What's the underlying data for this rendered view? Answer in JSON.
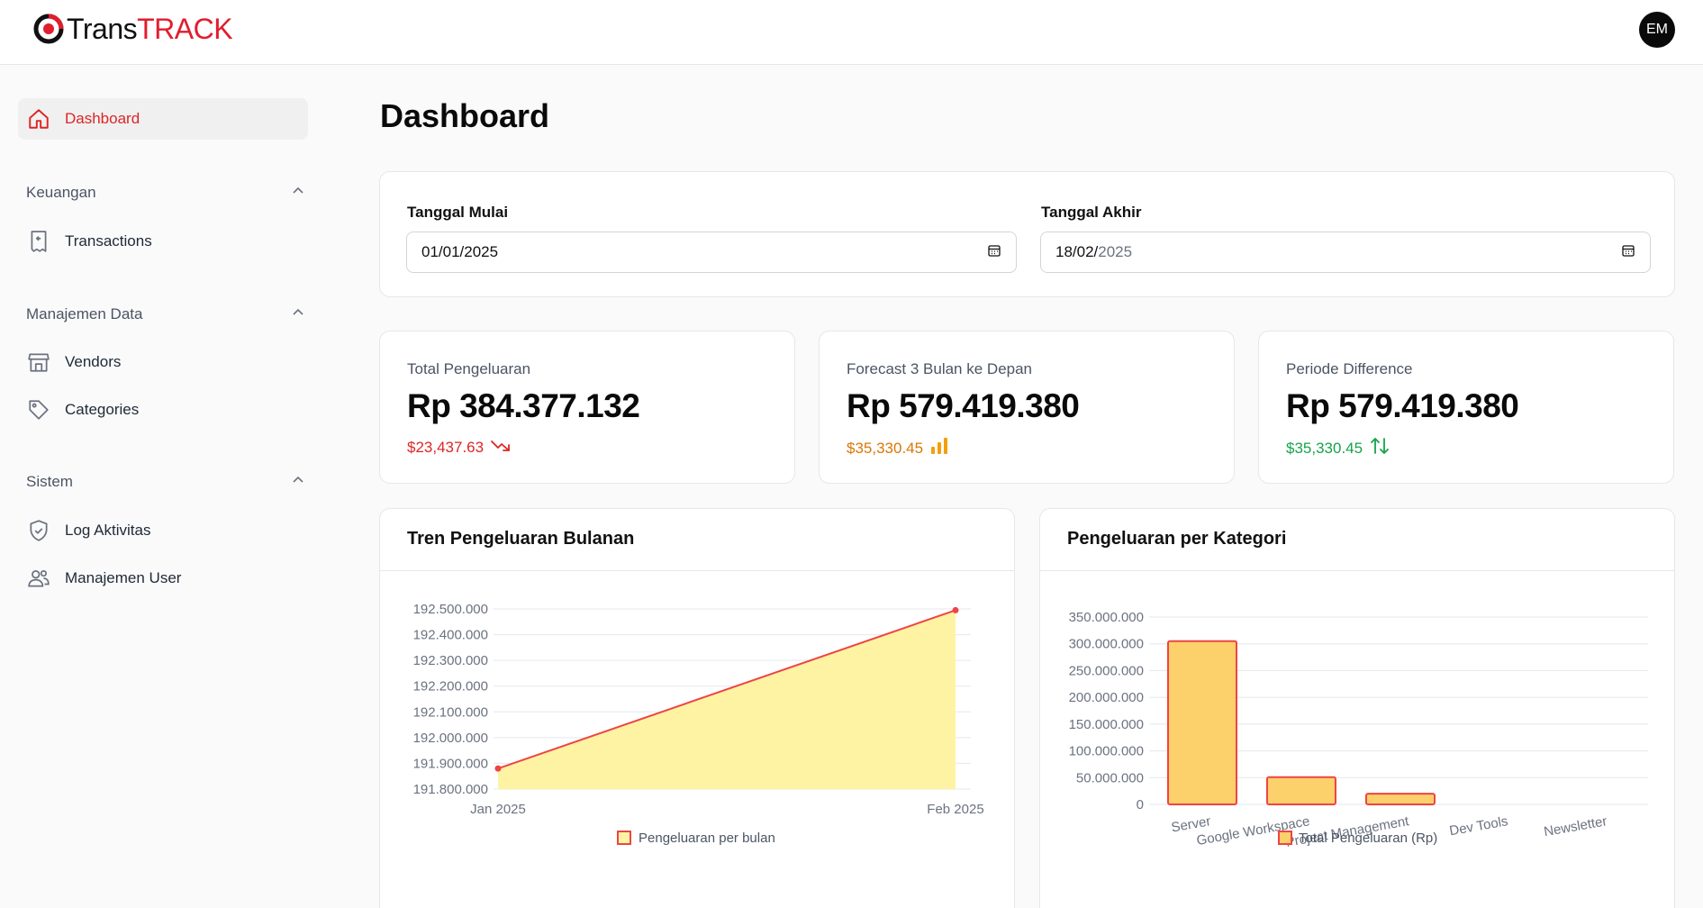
{
  "brand": {
    "name_part1": "Trans",
    "name_part2": "TRACK",
    "accent_color": "#e11d2e"
  },
  "user": {
    "initials": "EM"
  },
  "sidebar": {
    "dashboard": {
      "label": "Dashboard",
      "icon": "home-icon",
      "active": true
    },
    "groups": [
      {
        "title": "Keuangan",
        "items": [
          {
            "label": "Transactions",
            "icon": "receipt-icon"
          }
        ]
      },
      {
        "title": "Manajemen Data",
        "items": [
          {
            "label": "Vendors",
            "icon": "store-icon"
          },
          {
            "label": "Categories",
            "icon": "tag-icon"
          }
        ]
      },
      {
        "title": "Sistem",
        "items": [
          {
            "label": "Log Aktivitas",
            "icon": "shield-icon"
          },
          {
            "label": "Manajemen User",
            "icon": "users-icon"
          }
        ]
      }
    ]
  },
  "page": {
    "title": "Dashboard"
  },
  "filters": {
    "start": {
      "label": "Tanggal Mulai",
      "value": "01/01/2025"
    },
    "end": {
      "label": "Tanggal Akhir",
      "value_day_month": "18/02/",
      "value_year": "2025"
    }
  },
  "stats": [
    {
      "label": "Total Pengeluaran",
      "value": "Rp 384.377.132",
      "sub": "$23,437.63",
      "sub_color": "#dc2626",
      "sub_icon": "trend-down-icon"
    },
    {
      "label": "Forecast 3 Bulan ke Depan",
      "value": "Rp 579.419.380",
      "sub": "$35,330.45",
      "sub_color": "#d97706",
      "sub_icon": "bar-chart-icon"
    },
    {
      "label": "Periode Difference",
      "value": "Rp 579.419.380",
      "sub": "$35,330.45",
      "sub_color": "#16a34a",
      "sub_icon": "arrows-up-down-icon"
    }
  ],
  "charts": {
    "trend_title": "Tren Pengeluaran Bulanan",
    "category_title": "Pengeluaran per Kategori"
  },
  "chart_data": [
    {
      "type": "area",
      "title": "Tren Pengeluaran Bulanan",
      "x": [
        "Jan 2025",
        "Feb 2025"
      ],
      "series": [
        {
          "name": "Pengeluaran per bulan",
          "values": [
            191880000,
            192495000
          ]
        }
      ],
      "yticks": [
        "191.800.000",
        "191.900.000",
        "192.000.000",
        "192.100.000",
        "192.200.000",
        "192.300.000",
        "192.400.000",
        "192.500.000"
      ],
      "ylim": [
        191800000,
        192500000
      ],
      "line_color": "#ef4444",
      "fill_color": "#fef3a3",
      "legend": "bottom",
      "grid": true
    },
    {
      "type": "bar",
      "title": "Pengeluaran per Kategori",
      "categories": [
        "Server",
        "Google Workspace",
        "Project Management",
        "Dev Tools",
        "Newsletter"
      ],
      "series": [
        {
          "name": "Total Pengeluaran (Rp)",
          "values": [
            305000000,
            51000000,
            20000000,
            0,
            0
          ]
        }
      ],
      "yticks": [
        "0",
        "50.000.000",
        "100.000.000",
        "150.000.000",
        "200.000.000",
        "250.000.000",
        "300.000.000",
        "350.000.000"
      ],
      "ylim": [
        0,
        350000000
      ],
      "bar_color": "#fcd06b",
      "border_color": "#ef4444",
      "legend": "bottom",
      "grid": true
    }
  ]
}
